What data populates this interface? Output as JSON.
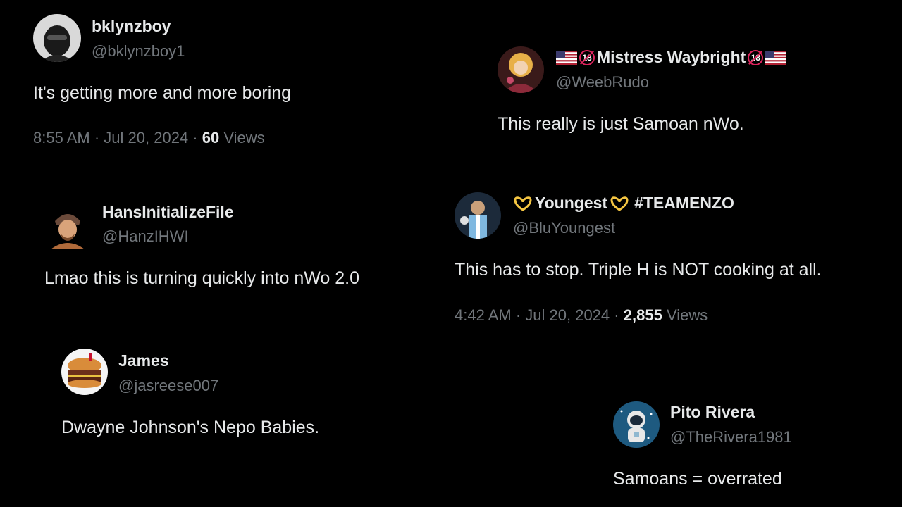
{
  "tweets": [
    {
      "name": "bklynzboy",
      "handle": "@bklynzboy1",
      "text": "It's getting more and more boring",
      "time": "8:55 AM",
      "date": "Jul 20, 2024",
      "views_count": "60",
      "views_label": "Views"
    },
    {
      "name": "Mistress Waybright",
      "name_prefix_badge": "18",
      "name_suffix_badge": "18",
      "handle": "@WeebRudo",
      "text": "This really is just Samoan nWo."
    },
    {
      "name": "HansInitializeFile",
      "handle": "@HanzIHWI",
      "text": "Lmao this is turning quickly into nWo 2.0"
    },
    {
      "name": "Youngest",
      "name_suffix": "#TEAMENZO",
      "handle": "@BluYoungest",
      "text": "This has to stop. Triple H is NOT cooking at all.",
      "time": "4:42 AM",
      "date": "Jul 20, 2024",
      "views_count": "2,855",
      "views_label": "Views"
    },
    {
      "name": "James",
      "handle": "@jasreese007",
      "text": "Dwayne Johnson's Nepo Babies."
    },
    {
      "name": "Pito Rivera",
      "handle": "@TheRivera1981",
      "text": "Samoans = overrated"
    }
  ],
  "separator": "·",
  "colors": {
    "background": "#000000",
    "primary_text": "#e7e9ea",
    "secondary_text": "#71767b"
  }
}
